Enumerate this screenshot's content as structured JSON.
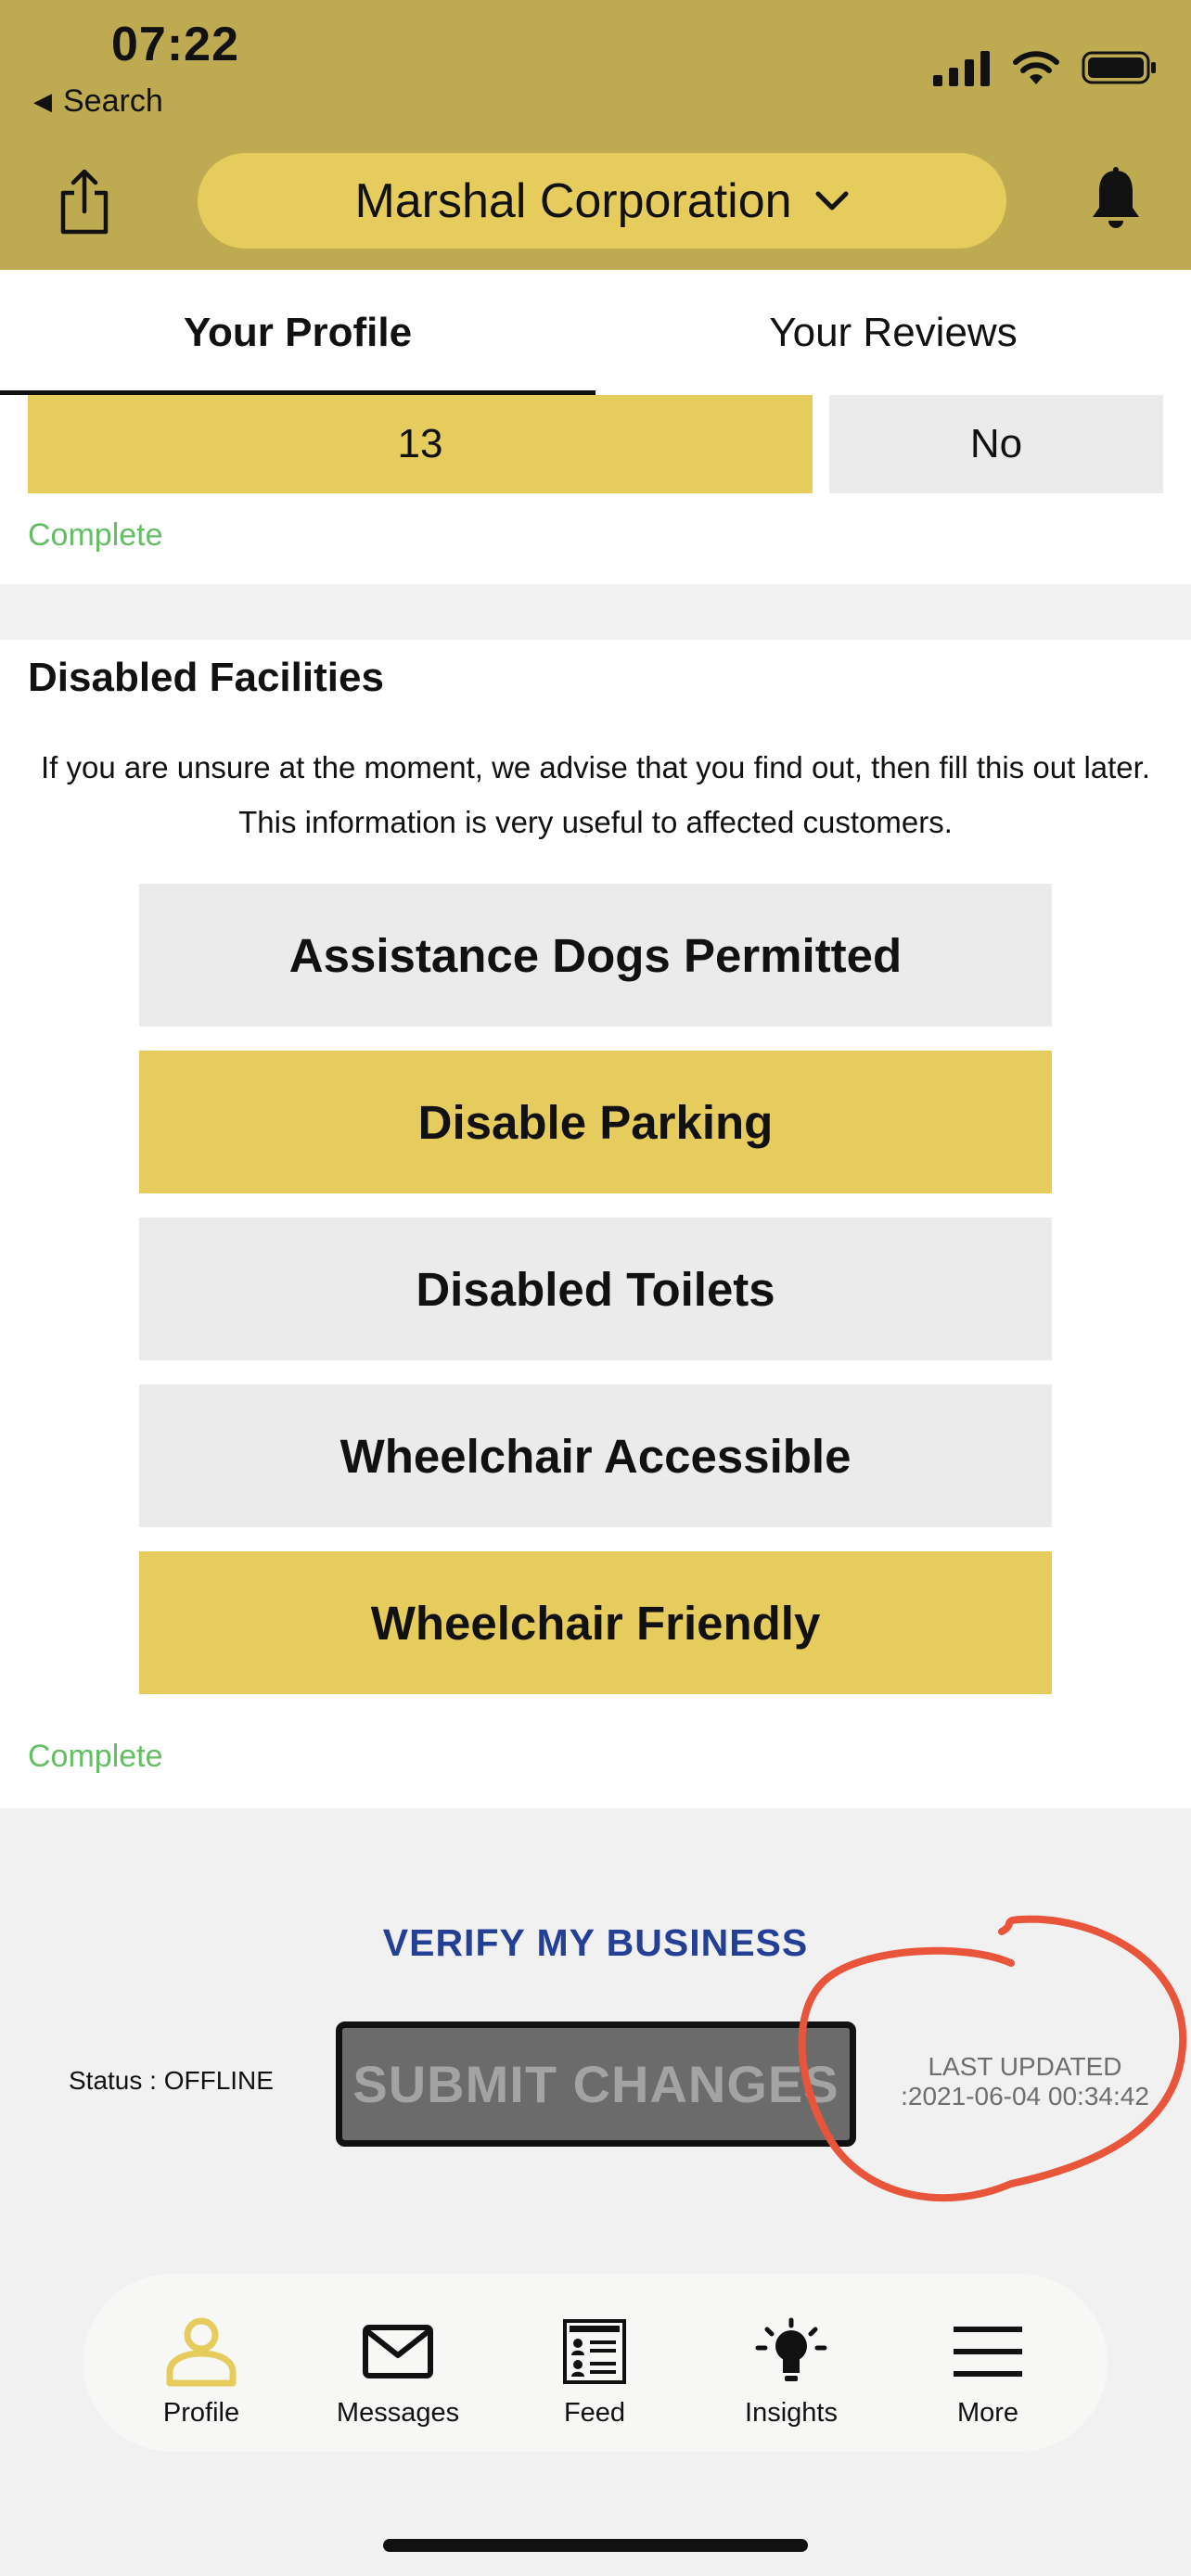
{
  "status_bar": {
    "time": "07:22",
    "back_label": "Search"
  },
  "header": {
    "business_name": "Marshal Corporation"
  },
  "tabs": [
    {
      "label": "Your Profile",
      "active": true
    },
    {
      "label": "Your Reviews",
      "active": false
    }
  ],
  "top_card": {
    "options": [
      {
        "label": "13",
        "selected": true
      },
      {
        "label": "No",
        "selected": false
      }
    ],
    "status": "Complete"
  },
  "facilities": {
    "title": "Disabled Facilities",
    "description": "If you are unsure at the moment, we advise that you find out, then fill this out later. This information is very useful to affected customers.",
    "options": [
      {
        "label": "Assistance Dogs Permitted",
        "selected": false
      },
      {
        "label": "Disable Parking",
        "selected": true
      },
      {
        "label": "Disabled Toilets",
        "selected": false
      },
      {
        "label": "Wheelchair Accessible",
        "selected": false
      },
      {
        "label": "Wheelchair Friendly",
        "selected": true
      }
    ],
    "status": "Complete"
  },
  "actions": {
    "verify_label": "VERIFY MY BUSINESS",
    "status_text": "Status : OFFLINE",
    "submit_label": "SUBMIT CHANGES",
    "last_updated_label": "LAST UPDATED",
    "last_updated_value": ":2021-06-04 00:34:42"
  },
  "tabbar": [
    {
      "label": "Profile",
      "icon": "person-icon",
      "active": true
    },
    {
      "label": "Messages",
      "icon": "envelope-icon",
      "active": false
    },
    {
      "label": "Feed",
      "icon": "feed-icon",
      "active": false
    },
    {
      "label": "Insights",
      "icon": "lightbulb-icon",
      "active": false
    },
    {
      "label": "More",
      "icon": "menu-icon",
      "active": false
    }
  ],
  "colors": {
    "header_bg": "#beaa51",
    "accent_yellow": "#e6cc5d",
    "unselected_gray": "#ebebeb",
    "complete_green": "#64be64",
    "verify_blue": "#243f96",
    "annotation_red": "#e8553a"
  }
}
